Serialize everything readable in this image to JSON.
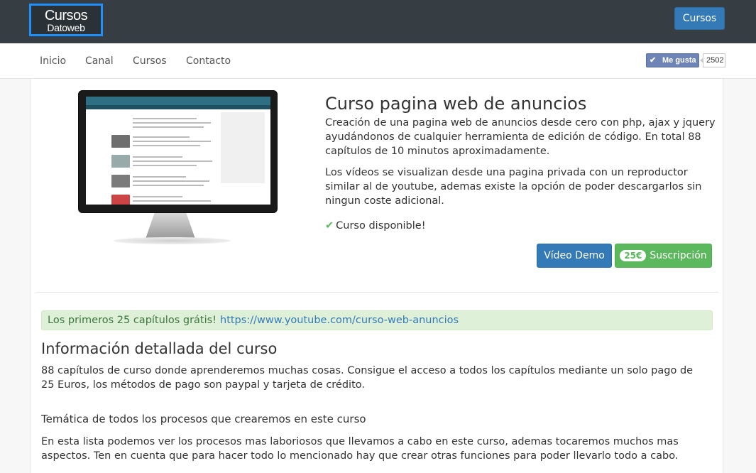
{
  "header": {
    "logo_line1": "Cursos",
    "logo_line2": "Datoweb",
    "cursos_button": "Cursos"
  },
  "nav": {
    "items": [
      "Inicio",
      "Canal",
      "Cursos",
      "Contacto"
    ],
    "like_label": "Me gusta",
    "like_count": "2502"
  },
  "course": {
    "title": "Curso pagina web de anuncios",
    "desc1": "Creación de una pagina web de anuncios desde cero con php, ajax y jquery ayudándonos de cualquier herramienta de edición de código. En total 88 capítulos de 10 minutos aproximadamente.",
    "desc2": "Los vídeos se visualizan desde una pagina privada con un reproductor similar al de youtube, ademas existe la opción de poder descargarlos sin ningun coste adicional.",
    "available": "Curso disponible!",
    "demo_button": "Vídeo Demo",
    "price": "25€",
    "subscribe_label": "Suscripción"
  },
  "alert": {
    "text": "Los primeros 25 capítulos grátis!",
    "link": "https://www.youtube.com/curso-web-anuncios"
  },
  "details": {
    "heading": "Información detallada del curso",
    "paragraph": "88 capítulos de curso donde aprenderemos muchas cosas. Consigue el acceso a todos los capítulos mediante un solo pago de 25 Euros, los métodos de pago son paypal y tarjeta de crédito.",
    "subheading": "Temática de todos los procesos que crearemos en este curso",
    "paragraph2": "En esta lista podemos ver los procesos mas laboriosos que llevamos a cabo en este curso, ademas tocaremos muchos mas aspectos. Ten en cuenta que para hacer todo lo mencionado hay que crear otras funciones para poder llevarlo todo a cabo."
  },
  "colors": {
    "topbar": "#363e44",
    "primary": "#337ab7",
    "success": "#5cb85c",
    "alert_bg": "#dff0d8"
  }
}
